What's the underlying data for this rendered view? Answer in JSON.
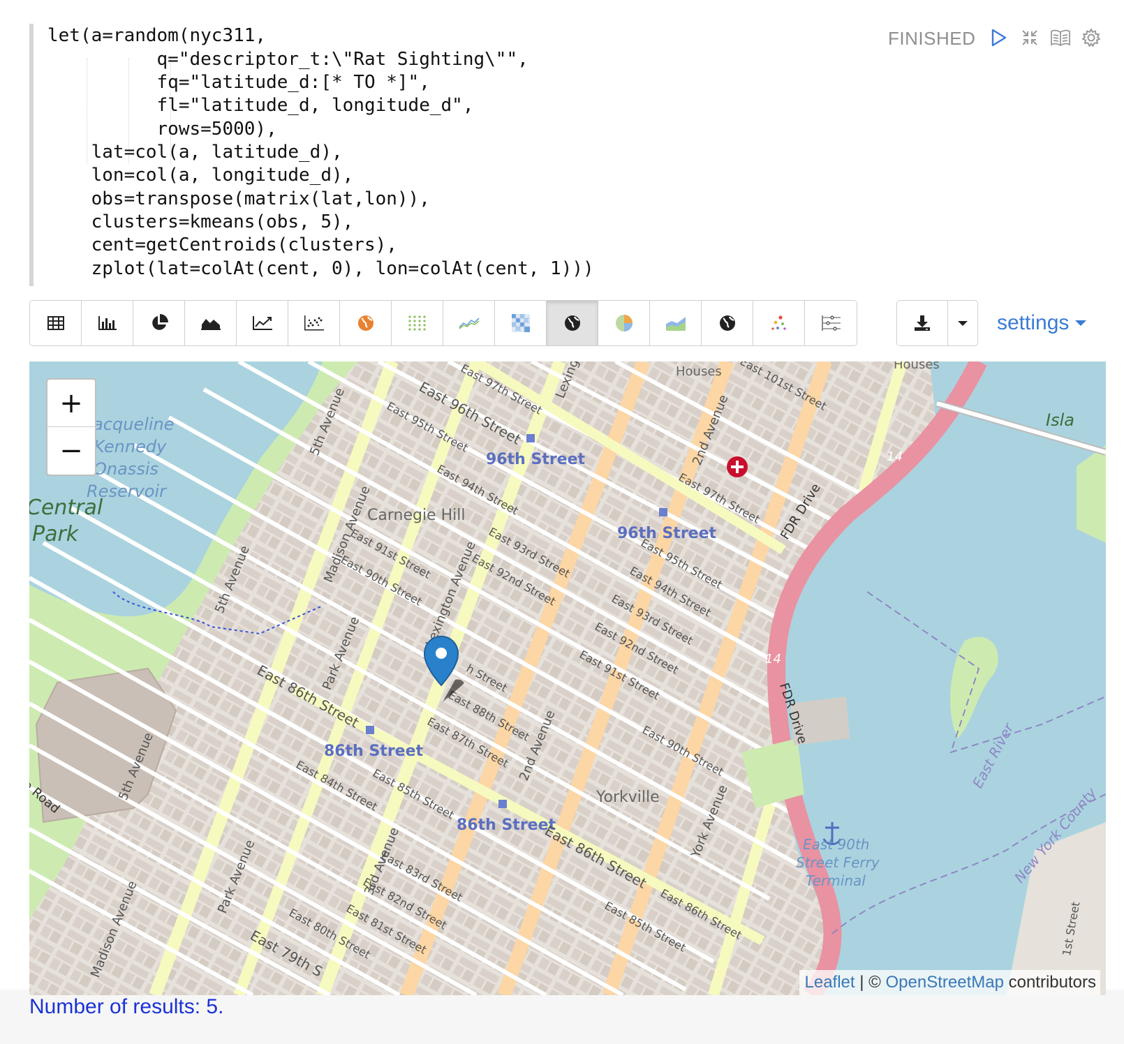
{
  "editor": {
    "lines": [
      "let(a=random(nyc311,",
      "          q=\"descriptor_t:\\\"Rat Sighting\\\"\",",
      "          fq=\"latitude_d:[* TO *]\",",
      "          fl=\"latitude_d, longitude_d\",",
      "          rows=5000),",
      "    lat=col(a, latitude_d),",
      "    lon=col(a, longitude_d),",
      "    obs=transpose(matrix(lat,lon)),",
      "    clusters=kmeans(obs, 5),",
      "    cent=getCentroids(clusters),",
      "    zplot(lat=colAt(cent, 0), lon=colAt(cent, 1)))"
    ]
  },
  "status": {
    "label": "FINISHED",
    "icons": [
      "run-icon",
      "hide-editor-icon",
      "book-icon",
      "gear-icon"
    ]
  },
  "toolbar": {
    "buttons": [
      {
        "icon": "table-icon"
      },
      {
        "icon": "bar-chart-icon"
      },
      {
        "icon": "pie-chart-icon"
      },
      {
        "icon": "area-chart-icon"
      },
      {
        "icon": "line-chart-icon"
      },
      {
        "icon": "scatter-chart-icon"
      },
      {
        "icon": "globe-orange-icon"
      },
      {
        "icon": "dot-matrix-icon"
      },
      {
        "icon": "multi-line-icon"
      },
      {
        "icon": "heatmap-icon"
      },
      {
        "icon": "globe-icon",
        "active": true
      },
      {
        "icon": "pie-color-icon"
      },
      {
        "icon": "stacked-area-icon"
      },
      {
        "icon": "globe-icon"
      },
      {
        "icon": "bubble-icon"
      },
      {
        "icon": "parallel-coords-icon"
      }
    ],
    "download_icon": "download-icon",
    "dropdown_icon": "caret-down-icon",
    "settings_label": "settings"
  },
  "map": {
    "zoom_in": "+",
    "zoom_out": "−",
    "attribution": {
      "leaflet": "Leaflet",
      "separator": " | © ",
      "osm": "OpenStreetMap",
      "suffix": " contributors"
    },
    "labels": {
      "central_park": "Central",
      "park": "Park",
      "reservoir_1": "Jacqueline",
      "reservoir_2": "Kennedy",
      "reservoir_3": "Onassis",
      "reservoir_4": "Reservoir",
      "carnegie_hill": "Carnegie Hill",
      "yorkville": "Yorkville",
      "houses_1": "Houses",
      "houses_2": "Houses",
      "station_96_a": "96th Street",
      "station_96_b": "96th Street",
      "station_86_a": "86th Street",
      "station_86_b": "86th Street",
      "fdr_1": "FDR Drive",
      "fdr_2": "FDR Drive",
      "east_river": "East River",
      "ny_county": "New York County",
      "ferry_1": "East 90th",
      "ferry_2": "Street Ferry",
      "ferry_3": "Terminal",
      "route_1": "14",
      "route_2": "14",
      "island": "Isla",
      "road": "e Road",
      "fifth_ave_1": "5th Avenue",
      "fifth_ave_2": "5th Avenue",
      "fifth_ave_3": "5th Avenue",
      "madison_1": "Madison Avenue",
      "madison_2": "Madison Avenue",
      "park_ave_1": "Park Avenue",
      "park_ave_2": "Park Avenue",
      "lexington_1": "Lexington Avenue",
      "lexington_2": "Lexing",
      "third_ave": "3rd Avenue",
      "second_ave_1": "2nd Avenue",
      "second_ave_2": "2nd Avenue",
      "york_ave": "York Avenue",
      "first_st": "1st Street",
      "e97_a": "East 97th Street",
      "e96_a": "East 96th Street",
      "e95_a": "East 95th Street",
      "e94_a": "East 94th Street",
      "e93_a": "East 93rd Street",
      "e92_a": "East 92nd Street",
      "e91_a": "East 91st Street",
      "e90_a": "East 90th Street",
      "e88_a": "East 88th Street",
      "e87_a": "East 87th Street",
      "e86_a": "East 86th Street",
      "e86_b": "East 86th Street",
      "e86_c": "East 86th Street",
      "e85_a": "East 85th Street",
      "e85_b": "East 85th Street",
      "e84_a": "East 84th Street",
      "e83_a": "East 83rd Street",
      "e82_a": "East 82nd Street",
      "e81_a": "East 81st Street",
      "e80_a": "East 80th Street",
      "e79_a": "East 79th S",
      "e101": "East 101st Street",
      "e97_b": "East 97th Street",
      "e95_b": "East 95th Street",
      "e94_b": "East 94th Street",
      "e93_b": "East 93rd Street",
      "e92_b": "East 92nd Street",
      "e91_b": "East 91st Street",
      "e90_b": "East 90th Street",
      "e89_partial": "h Street"
    }
  },
  "results": {
    "text": "Number of results: 5."
  }
}
